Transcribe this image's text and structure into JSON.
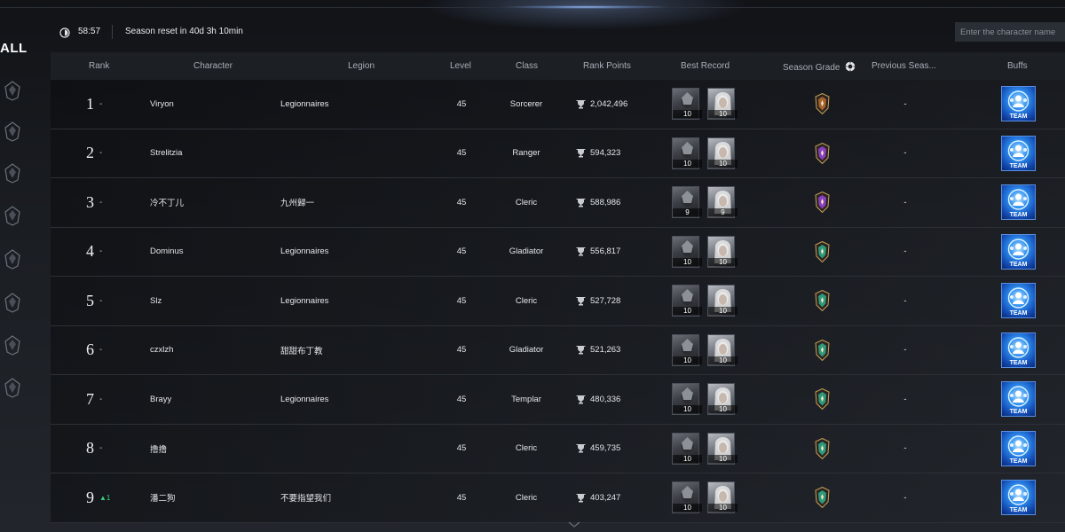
{
  "header": {
    "timer": "58:57",
    "reset_text": "Season reset in 40d 3h 10min",
    "search_placeholder": "Enter the character name"
  },
  "sidebar": {
    "all_label": "ALL",
    "icons": [
      "class-gladiator-icon",
      "class-templar-icon",
      "class-assassin-icon",
      "class-ranger-icon",
      "class-sorcerer-icon",
      "class-spiritmaster-icon",
      "class-cleric-icon",
      "class-chanter-icon"
    ]
  },
  "columns": {
    "rank": "Rank",
    "character": "Character",
    "legion": "Legion",
    "level": "Level",
    "class": "Class",
    "rank_points": "Rank Points",
    "best_record": "Best Record",
    "season_grade": "Season Grade",
    "previous_season": "Previous Seas...",
    "buffs": "Buffs"
  },
  "buff_label": "TEAM",
  "grade_colors": {
    "bronze": "#a8632c",
    "purple": "#8a3fc0",
    "teal": "#2e9a7a"
  },
  "rows": [
    {
      "rank": "1",
      "change": "",
      "character": "Viryon",
      "legion": "Legionnaires",
      "level": "45",
      "class": "Sorcerer",
      "points": "2,042,496",
      "best": [
        "10",
        "10"
      ],
      "grade": "bronze",
      "previous": "-"
    },
    {
      "rank": "2",
      "change": "",
      "character": "Strelitzia",
      "legion": "",
      "level": "45",
      "class": "Ranger",
      "points": "594,323",
      "best": [
        "10",
        "10"
      ],
      "grade": "purple",
      "previous": "-"
    },
    {
      "rank": "3",
      "change": "",
      "character": "冷不丁儿",
      "legion": "九州歸一",
      "level": "45",
      "class": "Cleric",
      "points": "588,986",
      "best": [
        "9",
        "9"
      ],
      "grade": "purple",
      "previous": "-"
    },
    {
      "rank": "4",
      "change": "",
      "character": "Dominus",
      "legion": "Legionnaires",
      "level": "45",
      "class": "Gladiator",
      "points": "556,817",
      "best": [
        "10",
        "10"
      ],
      "grade": "teal",
      "previous": "-"
    },
    {
      "rank": "5",
      "change": "",
      "character": "Slz",
      "legion": "Legionnaires",
      "level": "45",
      "class": "Cleric",
      "points": "527,728",
      "best": [
        "10",
        "10"
      ],
      "grade": "teal",
      "previous": "-"
    },
    {
      "rank": "6",
      "change": "",
      "character": "czxlzh",
      "legion": "甜甜布丁教",
      "level": "45",
      "class": "Gladiator",
      "points": "521,263",
      "best": [
        "10",
        "10"
      ],
      "grade": "teal",
      "previous": "-"
    },
    {
      "rank": "7",
      "change": "",
      "character": "Brayy",
      "legion": "Legionnaires",
      "level": "45",
      "class": "Templar",
      "points": "480,336",
      "best": [
        "10",
        "10"
      ],
      "grade": "teal",
      "previous": "-"
    },
    {
      "rank": "8",
      "change": "",
      "character": "撸撸",
      "legion": "",
      "level": "45",
      "class": "Cleric",
      "points": "459,735",
      "best": [
        "10",
        "10"
      ],
      "grade": "teal",
      "previous": "-"
    },
    {
      "rank": "9",
      "change": "▲1",
      "character": "潘二狗",
      "legion": "不要指望我们",
      "level": "45",
      "class": "Cleric",
      "points": "403,247",
      "best": [
        "10",
        "10"
      ],
      "grade": "teal",
      "previous": "-"
    }
  ]
}
